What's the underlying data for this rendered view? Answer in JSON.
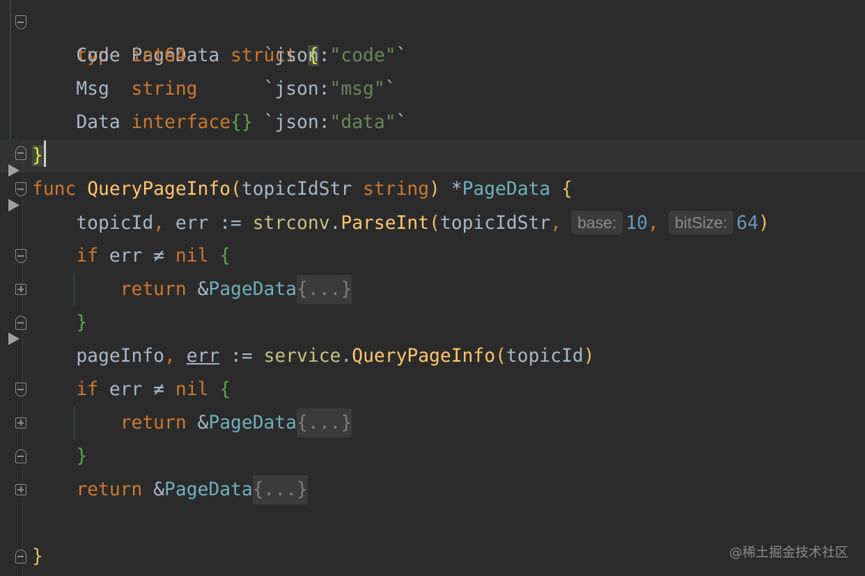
{
  "colors": {
    "background": "#2b2b2b",
    "keyword": "#cc7832",
    "type": "#6fafbd",
    "function": "#ffc66d",
    "string": "#6a8759",
    "number": "#6897bb",
    "default": "#a9b7c6",
    "brace_struct": "#f2e233",
    "brace_func": "#e8bf6a",
    "brace_inner": "#57a64a"
  },
  "icons": [
    "fold-open-icon",
    "fold-close-icon",
    "fold-collapsed-icon",
    "run-arrow-icon"
  ],
  "code": {
    "l1": {
      "kw": "type",
      "name": "PageData",
      "kw2": "struct",
      "brace": "{"
    },
    "l2": {
      "field": "Code",
      "type": "int64",
      "tag_open": "`json:",
      "tag_str": "\"code\"",
      "tag_close": "`"
    },
    "l3": {
      "field": "Msg",
      "type": "string",
      "tag_open": "`json:",
      "tag_str": "\"msg\"",
      "tag_close": "`"
    },
    "l4": {
      "field": "Data",
      "type": "interface",
      "type_braces": "{}",
      "tag_open": "`json:",
      "tag_str": "\"data\"",
      "tag_close": "`"
    },
    "l5": {
      "brace": "}"
    },
    "l6": {
      "kw": "func",
      "name": "QueryPageInfo",
      "paren_open": "(",
      "param": "topicIdStr",
      "param_type": "string",
      "paren_close": ")",
      "star": "*",
      "ret": "PageData",
      "brace": "{"
    },
    "l7": {
      "var1": "topicId",
      "comma": ",",
      "var2": "err",
      "op": ":=",
      "pkg": "strconv",
      "dot": ".",
      "fn": "ParseInt",
      "paren_open": "(",
      "arg1": "topicIdStr",
      "comma2": ",",
      "hint1": "base:",
      "num1": "10",
      "comma3": ",",
      "hint2": "bitSize:",
      "num2": "64",
      "paren_close": ")"
    },
    "l8": {
      "kw": "if",
      "var": "err",
      "op": "≠",
      "kw2": "nil",
      "brace": "{"
    },
    "l9": {
      "kw": "return",
      "amp": "&",
      "type": "PageData",
      "fold": "{...}"
    },
    "l10": {
      "brace": "}"
    },
    "l11": {
      "var1": "pageInfo",
      "comma": ",",
      "var2": "err",
      "op": ":=",
      "pkg": "service",
      "dot": ".",
      "fn": "QueryPageInfo",
      "paren_open": "(",
      "arg": "topicId",
      "paren_close": ")"
    },
    "l12": {
      "kw": "if",
      "var": "err",
      "op": "≠",
      "kw2": "nil",
      "brace": "{"
    },
    "l13": {
      "kw": "return",
      "amp": "&",
      "type": "PageData",
      "fold": "{...}"
    },
    "l14": {
      "brace": "}"
    },
    "l15": {
      "kw": "return",
      "amp": "&",
      "type": "PageData",
      "fold": "{...}"
    },
    "l17": {
      "brace": "}"
    }
  },
  "watermark": "@稀土掘金技术社区"
}
